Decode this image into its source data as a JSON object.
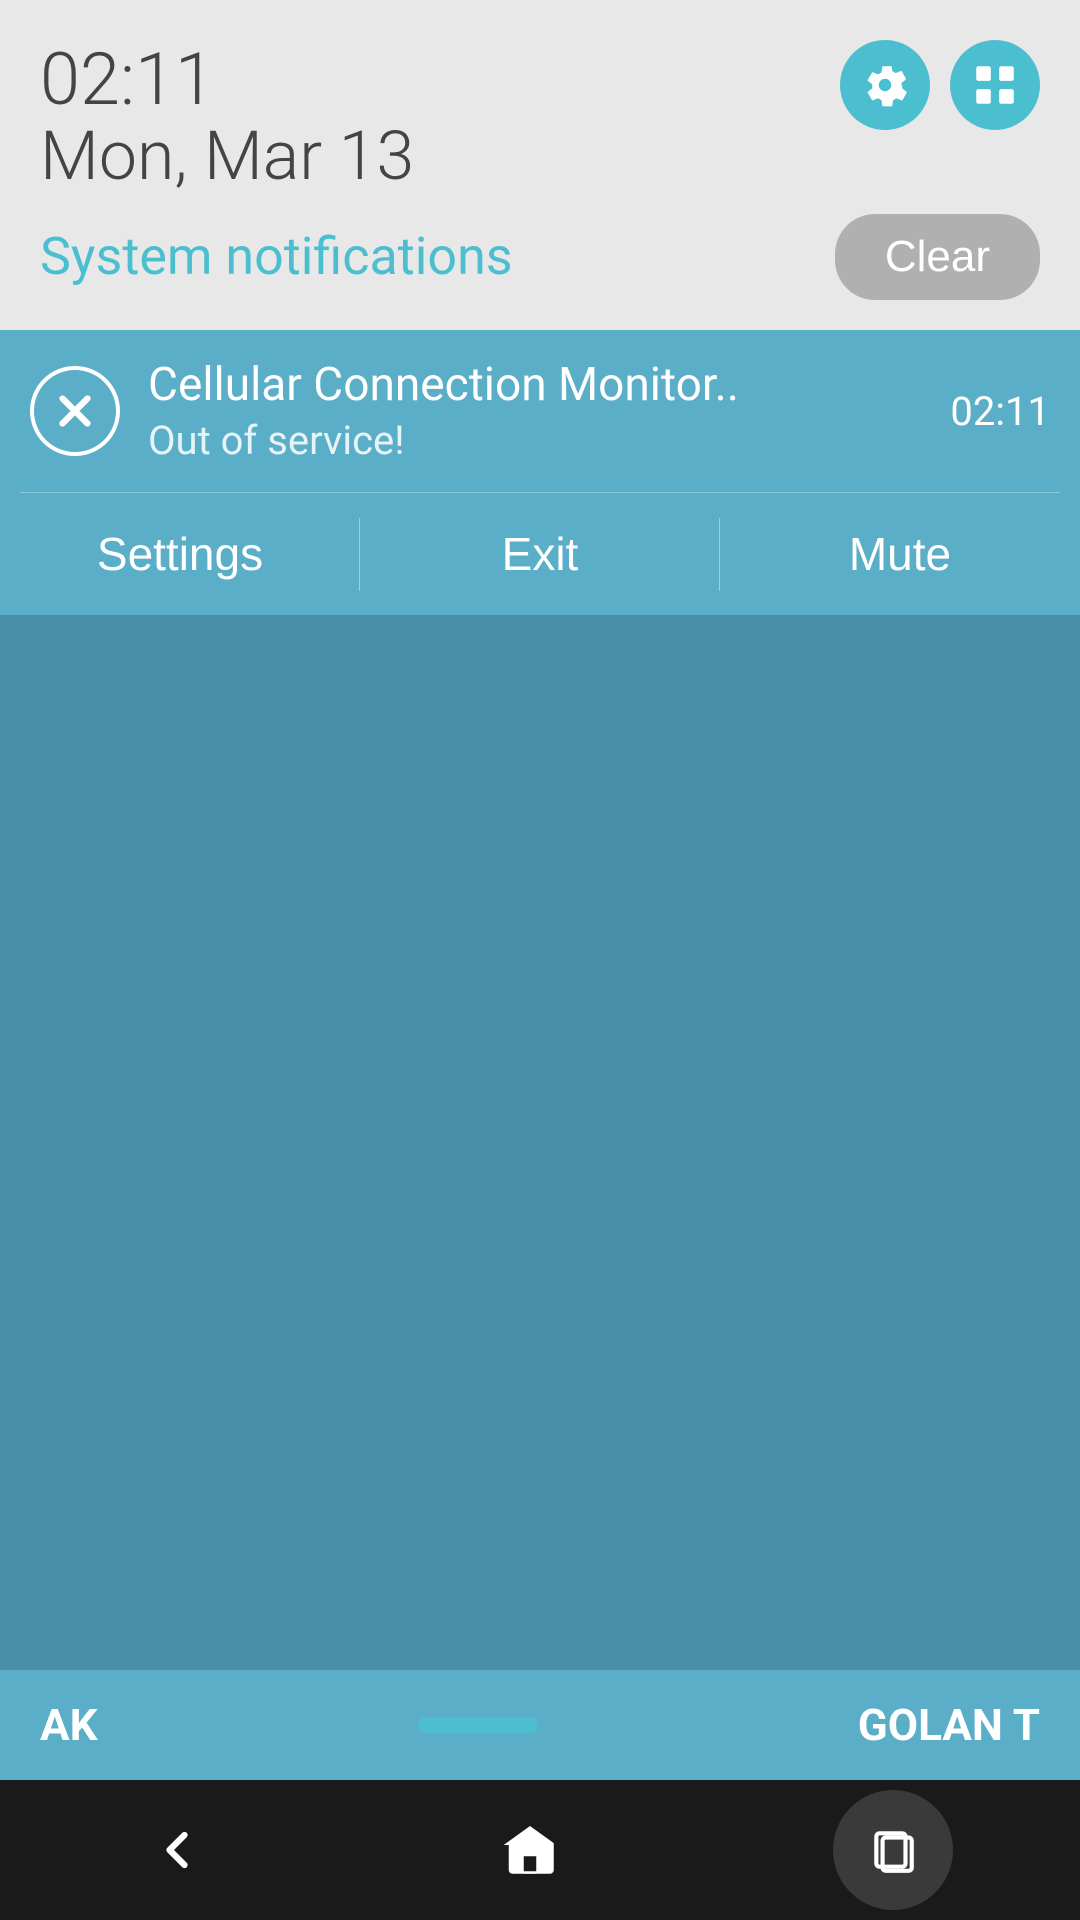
{
  "header": {
    "time": "02:11",
    "date": "Mon, Mar 13",
    "system_notifications_label": "System notifications",
    "clear_button_label": "Clear"
  },
  "icons": {
    "settings": "gear-icon",
    "grid": "grid-icon"
  },
  "notification": {
    "title": "Cellular Connection Monitor..",
    "body": "Out of service!",
    "timestamp": "02:11",
    "actions": [
      {
        "label": "Settings"
      },
      {
        "label": "Exit"
      },
      {
        "label": "Mute"
      }
    ]
  },
  "taskbar": {
    "left_label": "AK",
    "right_label": "GOLAN T"
  },
  "navbar": {
    "back_label": "back",
    "home_label": "home",
    "recents_label": "recents"
  }
}
